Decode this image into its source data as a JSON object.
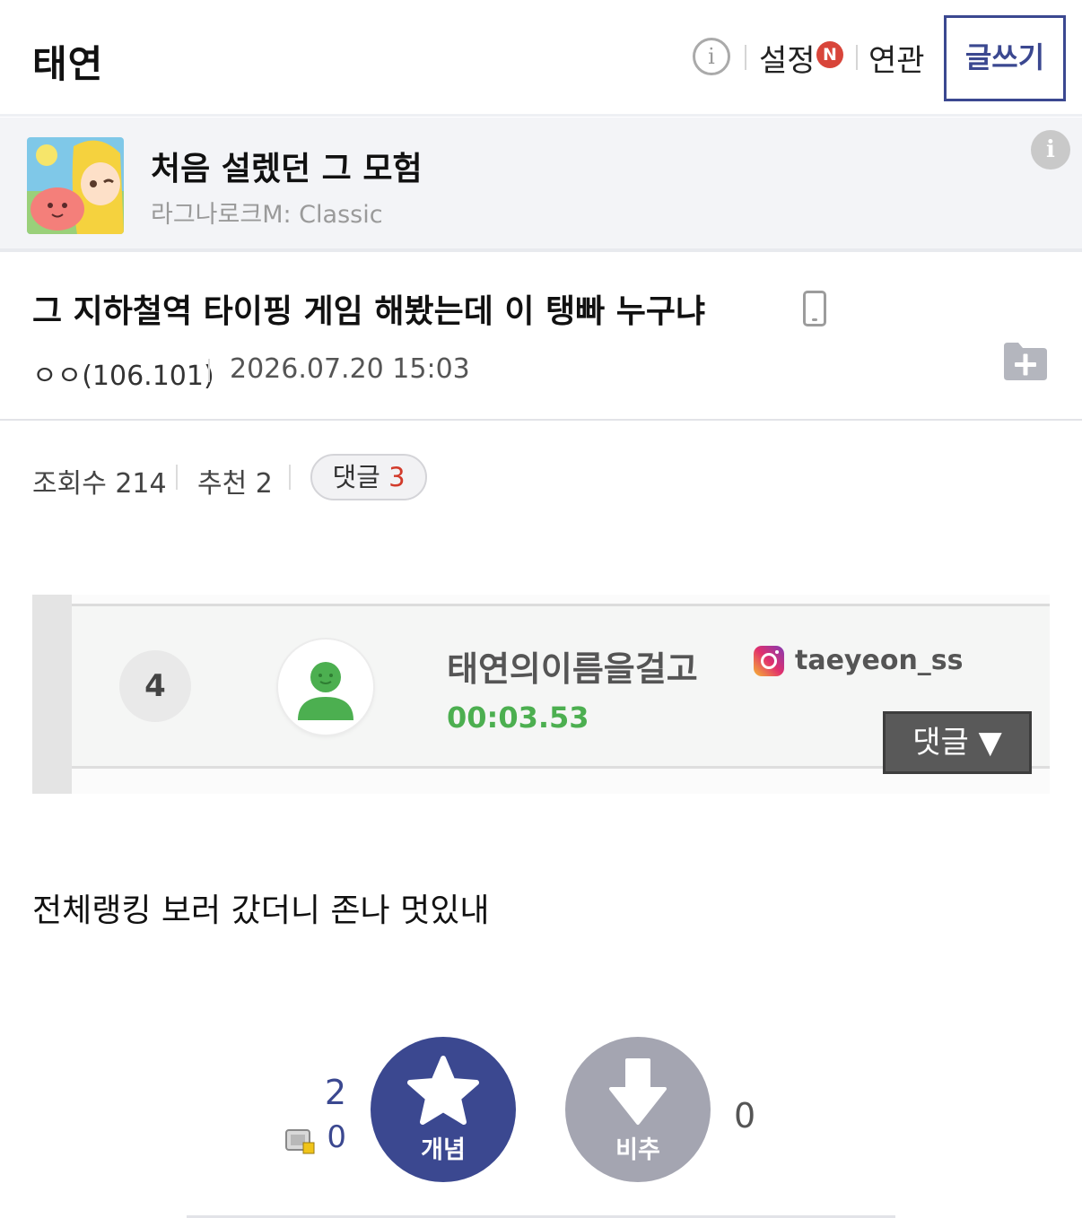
{
  "header": {
    "gallery_title": "태연",
    "info_glyph": "i",
    "settings_label": "설정",
    "new_badge": "N",
    "related_label": "연관",
    "write_button": "글쓰기"
  },
  "banner": {
    "title": "처음 설렜던 그 모험",
    "subtitle": "라그나로크M: Classic",
    "info_glyph": "i"
  },
  "post": {
    "title": "그 지하철역 타이핑 게임 해봤는데 이 탱빠 누구냐",
    "writer": "ㅇㅇ(106.101)",
    "date": "2026.07.20 15:03"
  },
  "stats": {
    "views_label": "조회수 214",
    "recommend_label": "추천 2",
    "comment_label": "댓글",
    "comment_count": "3"
  },
  "embed": {
    "rank": "4",
    "name": "태연의이름을걸고",
    "instagram_handle": "taeyeon_ss",
    "time": "00:03.53",
    "comment_button": "댓글 ▼"
  },
  "body_text": "전체랭킹 보러 갔더니 존나 멋있내",
  "vote": {
    "up_count": "2",
    "fixed_count": "0",
    "up_label": "개념",
    "down_label": "비추",
    "down_count": "0"
  },
  "icons": [
    "info-icon",
    "new-badge",
    "game-thumbnail",
    "mobile-phone-icon",
    "folder-add-icon",
    "user-avatar-icon",
    "instagram-icon",
    "star-icon",
    "down-arrow-icon",
    "fixed-user-icon"
  ],
  "colors": {
    "accent": "#3b4890",
    "badge_red": "#d8453a",
    "comment_count": "#d23a2a",
    "time_green": "#4caf50",
    "downvote_gray": "#a4a5b1"
  }
}
